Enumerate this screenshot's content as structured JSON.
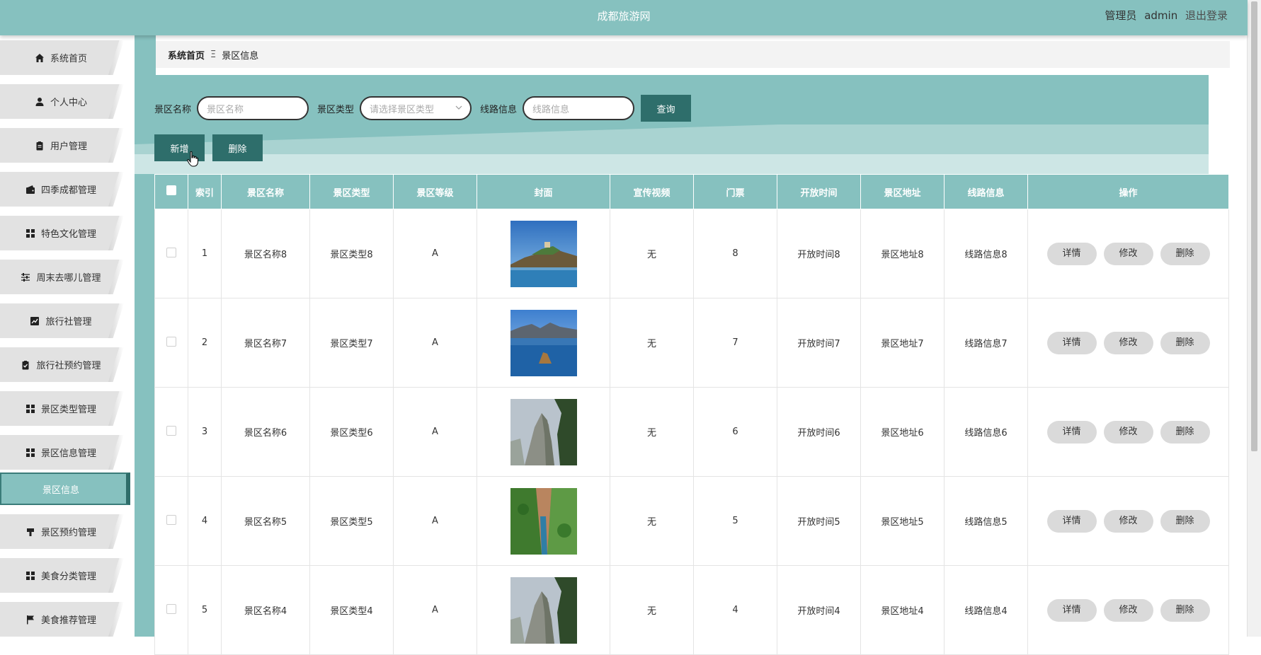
{
  "header": {
    "title": "成都旅游网",
    "role": "管理员",
    "username": "admin",
    "logout": "退出登录"
  },
  "sidebar": {
    "items": [
      {
        "label": "系统首页",
        "icon": "home-icon"
      },
      {
        "label": "个人中心",
        "icon": "user-icon"
      },
      {
        "label": "用户管理",
        "icon": "clipboard-icon"
      },
      {
        "label": "四季成都管理",
        "icon": "wallet-icon"
      },
      {
        "label": "特色文化管理",
        "icon": "grid-icon"
      },
      {
        "label": "周末去哪儿管理",
        "icon": "sliders-icon"
      },
      {
        "label": "旅行社管理",
        "icon": "chart-icon"
      },
      {
        "label": "旅行社预约管理",
        "icon": "clipboard-check-icon"
      },
      {
        "label": "景区类型管理",
        "icon": "grid-icon"
      },
      {
        "label": "景区信息管理",
        "icon": "grid-icon"
      },
      {
        "label": "景区预约管理",
        "icon": "podium-icon"
      },
      {
        "label": "美食分类管理",
        "icon": "grid-icon"
      },
      {
        "label": "美食推荐管理",
        "icon": "flag-icon"
      }
    ],
    "active_sub": "景区信息"
  },
  "breadcrumb": {
    "home": "系统首页",
    "separator": "Ξ",
    "current": "景区信息"
  },
  "search": {
    "name_label": "景区名称",
    "name_placeholder": "景区名称",
    "type_label": "景区类型",
    "type_placeholder": "请选择景区类型",
    "route_label": "线路信息",
    "route_placeholder": "线路信息",
    "query_button": "查询"
  },
  "actions": {
    "add": "新增",
    "delete": "删除"
  },
  "table": {
    "headers": [
      "索引",
      "景区名称",
      "景区类型",
      "景区等级",
      "封面",
      "宣传视频",
      "门票",
      "开放时间",
      "景区地址",
      "线路信息",
      "操作"
    ],
    "rows": [
      {
        "index": "1",
        "name": "景区名称8",
        "type": "景区类型8",
        "level": "A",
        "video": "无",
        "ticket": "8",
        "open": "开放时间8",
        "address": "景区地址8",
        "route": "线路信息8"
      },
      {
        "index": "2",
        "name": "景区名称7",
        "type": "景区类型7",
        "level": "A",
        "video": "无",
        "ticket": "7",
        "open": "开放时间7",
        "address": "景区地址7",
        "route": "线路信息7"
      },
      {
        "index": "3",
        "name": "景区名称6",
        "type": "景区类型6",
        "level": "A",
        "video": "无",
        "ticket": "6",
        "open": "开放时间6",
        "address": "景区地址6",
        "route": "线路信息6"
      },
      {
        "index": "4",
        "name": "景区名称5",
        "type": "景区类型5",
        "level": "A",
        "video": "无",
        "ticket": "5",
        "open": "开放时间5",
        "address": "景区地址5",
        "route": "线路信息5"
      },
      {
        "index": "5",
        "name": "景区名称4",
        "type": "景区类型4",
        "level": "A",
        "video": "无",
        "ticket": "4",
        "open": "开放时间4",
        "address": "景区地址4",
        "route": "线路信息4"
      }
    ],
    "row_actions": {
      "detail": "详情",
      "edit": "修改",
      "delete": "删除"
    }
  },
  "colors": {
    "teal": "#86c1bf",
    "dark_teal": "#2e6e6b",
    "light_gray": "#e2e2e2"
  }
}
